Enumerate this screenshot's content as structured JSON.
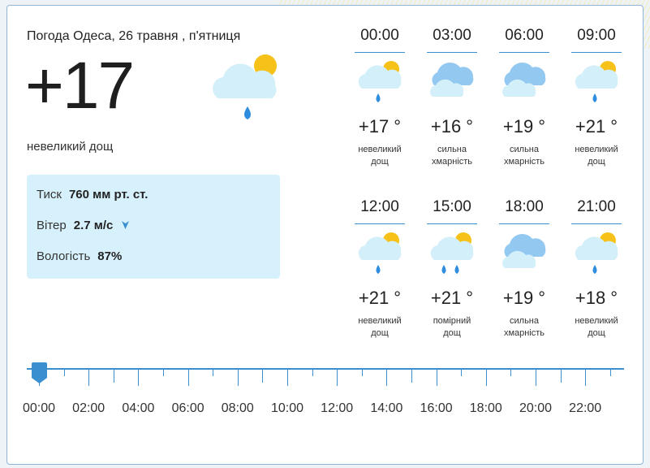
{
  "header": {
    "title": "Погода Одеса, 26 травня , п'ятниця"
  },
  "current": {
    "temp": "+17",
    "description": "невеликий дощ",
    "icon": "cloud-sun-rain-icon"
  },
  "details": {
    "pressure_label": "Тиск",
    "pressure_value": "760 мм рт. ст.",
    "wind_label": "Вітер",
    "wind_value": "2.7 м/с",
    "wind_icon": "wind-direction-arrow-icon",
    "humidity_label": "Вологість",
    "humidity_value": "87%"
  },
  "hours": [
    {
      "time": "00:00",
      "temp": "+17 °",
      "desc1": "невеликий",
      "desc2": "дощ",
      "icon": "sun-cloud-rain-icon"
    },
    {
      "time": "03:00",
      "temp": "+16 °",
      "desc1": "сильна",
      "desc2": "хмарність",
      "icon": "heavy-clouds-icon"
    },
    {
      "time": "06:00",
      "temp": "+19 °",
      "desc1": "сильна",
      "desc2": "хмарність",
      "icon": "heavy-clouds-icon"
    },
    {
      "time": "09:00",
      "temp": "+21 °",
      "desc1": "невеликий",
      "desc2": "дощ",
      "icon": "sun-cloud-rain-icon"
    },
    {
      "time": "12:00",
      "temp": "+21 °",
      "desc1": "невеликий",
      "desc2": "дощ",
      "icon": "sun-cloud-rain-icon"
    },
    {
      "time": "15:00",
      "temp": "+21 °",
      "desc1": "помірний",
      "desc2": "дощ",
      "icon": "sun-cloud-moderate-rain-icon"
    },
    {
      "time": "18:00",
      "temp": "+19 °",
      "desc1": "сильна",
      "desc2": "хмарність",
      "icon": "heavy-clouds-icon"
    },
    {
      "time": "21:00",
      "temp": "+18 °",
      "desc1": "невеликий",
      "desc2": "дощ",
      "icon": "sun-cloud-rain-icon"
    }
  ],
  "timeline": {
    "labels": [
      "00:00",
      "02:00",
      "04:00",
      "06:00",
      "08:00",
      "10:00",
      "12:00",
      "14:00",
      "16:00",
      "18:00",
      "20:00",
      "22:00"
    ],
    "selected": "00:00"
  },
  "colors": {
    "accent": "#3a8fd0",
    "info_bg": "#d6f1fb",
    "sun": "#f6c21a",
    "cloud_light": "#d3effa",
    "cloud_dark": "#93c8f0",
    "rain": "#2f8de0"
  }
}
